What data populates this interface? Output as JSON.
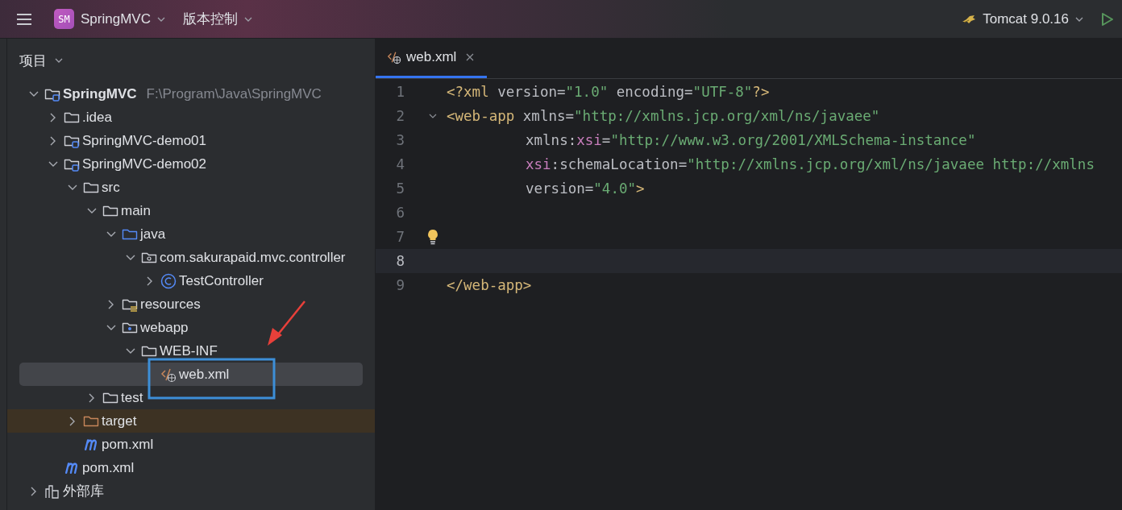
{
  "toolbar": {
    "project_badge": "SM",
    "project_name": "SpringMVC",
    "vcs_menu": "版本控制",
    "run_config": "Tomcat 9.0.16"
  },
  "project_panel": {
    "title": "项目",
    "tree": [
      {
        "label": "SpringMVC",
        "kind": "module",
        "hint": "F:\\Program\\Java\\SpringMVC",
        "expanded": true,
        "selected": false,
        "children": [
          {
            "label": ".idea",
            "kind": "folder",
            "expanded": false,
            "selected": false
          },
          {
            "label": "SpringMVC-demo01",
            "kind": "module",
            "expanded": false,
            "selected": false
          },
          {
            "label": "SpringMVC-demo02",
            "kind": "module",
            "expanded": true,
            "selected": false,
            "children": [
              {
                "label": "src",
                "kind": "folder",
                "expanded": true,
                "selected": false,
                "children": [
                  {
                    "label": "main",
                    "kind": "folder",
                    "expanded": true,
                    "selected": false,
                    "children": [
                      {
                        "label": "java",
                        "kind": "source",
                        "expanded": true,
                        "selected": false,
                        "children": [
                          {
                            "label": "com.sakurapaid.mvc.controller",
                            "kind": "package",
                            "expanded": true,
                            "selected": false,
                            "children": [
                              {
                                "label": "TestController",
                                "kind": "class",
                                "expanded": false,
                                "selected": false
                              }
                            ]
                          }
                        ]
                      },
                      {
                        "label": "resources",
                        "kind": "resources",
                        "expanded": false,
                        "selected": false
                      },
                      {
                        "label": "webapp",
                        "kind": "web",
                        "expanded": true,
                        "selected": false,
                        "children": [
                          {
                            "label": "WEB-INF",
                            "kind": "folder",
                            "expanded": true,
                            "selected": false,
                            "children": [
                              {
                                "label": "web.xml",
                                "kind": "xml",
                                "selected": true
                              }
                            ]
                          }
                        ]
                      }
                    ]
                  },
                  {
                    "label": "test",
                    "kind": "folder",
                    "expanded": false,
                    "selected": false
                  }
                ]
              },
              {
                "label": "target",
                "kind": "excluded",
                "expanded": false,
                "selected": false
              },
              {
                "label": "pom.xml",
                "kind": "maven",
                "selected": false
              }
            ]
          },
          {
            "label": "pom.xml",
            "kind": "maven",
            "selected": false
          }
        ]
      },
      {
        "label": "外部库",
        "kind": "library",
        "expanded": false,
        "selected": false
      }
    ]
  },
  "editor": {
    "tabs": [
      {
        "label": "web.xml",
        "selected": true
      }
    ],
    "lines": [
      {
        "number": "1",
        "indent": false,
        "fold": false,
        "hint": false,
        "current": false,
        "tokens": [
          {
            "kind": "tag",
            "text": "<?xml "
          },
          {
            "kind": "attr",
            "text": "version"
          },
          {
            "kind": "punct",
            "text": "="
          },
          {
            "kind": "value",
            "text": "\"1.0\""
          },
          {
            "kind": "attr",
            "text": " encoding"
          },
          {
            "kind": "punct",
            "text": "="
          },
          {
            "kind": "value",
            "text": "\"UTF-8\""
          },
          {
            "kind": "tag",
            "text": "?>"
          }
        ]
      },
      {
        "number": "2",
        "indent": false,
        "fold": true,
        "hint": false,
        "current": false,
        "tokens": [
          {
            "kind": "tag",
            "text": "<web-app "
          },
          {
            "kind": "attr",
            "text": "xmlns"
          },
          {
            "kind": "punct",
            "text": "="
          },
          {
            "kind": "value",
            "text": "\"http://xmlns.jcp.org/xml/ns/javaee\""
          }
        ]
      },
      {
        "number": "3",
        "indent": true,
        "fold": false,
        "hint": false,
        "current": false,
        "tokens": [
          {
            "kind": "attr",
            "text": "xmlns:"
          },
          {
            "kind": "ns",
            "text": "xsi"
          },
          {
            "kind": "punct",
            "text": "="
          },
          {
            "kind": "value",
            "text": "\"http://www.w3.org/2001/XMLSchema-instance\""
          }
        ]
      },
      {
        "number": "4",
        "indent": true,
        "fold": false,
        "hint": false,
        "current": false,
        "tokens": [
          {
            "kind": "ns",
            "text": "xsi"
          },
          {
            "kind": "attr",
            "text": ":schemaLocation"
          },
          {
            "kind": "punct",
            "text": "="
          },
          {
            "kind": "value",
            "text": "\"http://xmlns.jcp.org/xml/ns/javaee http://xmlns"
          }
        ]
      },
      {
        "number": "5",
        "indent": true,
        "fold": false,
        "hint": false,
        "current": false,
        "tokens": [
          {
            "kind": "attr",
            "text": "version"
          },
          {
            "kind": "punct",
            "text": "="
          },
          {
            "kind": "value",
            "text": "\"4.0\""
          },
          {
            "kind": "tag",
            "text": ">"
          }
        ]
      },
      {
        "number": "6",
        "fold": false,
        "hint": false,
        "current": false
      },
      {
        "number": "7",
        "fold": false,
        "hint": true,
        "current": false
      },
      {
        "number": "8",
        "fold": false,
        "hint": false,
        "current": true
      },
      {
        "number": "9",
        "indent": false,
        "fold": false,
        "hint": false,
        "current": false,
        "tokens": [
          {
            "kind": "tag",
            "text": "</web-app>"
          }
        ]
      }
    ]
  }
}
